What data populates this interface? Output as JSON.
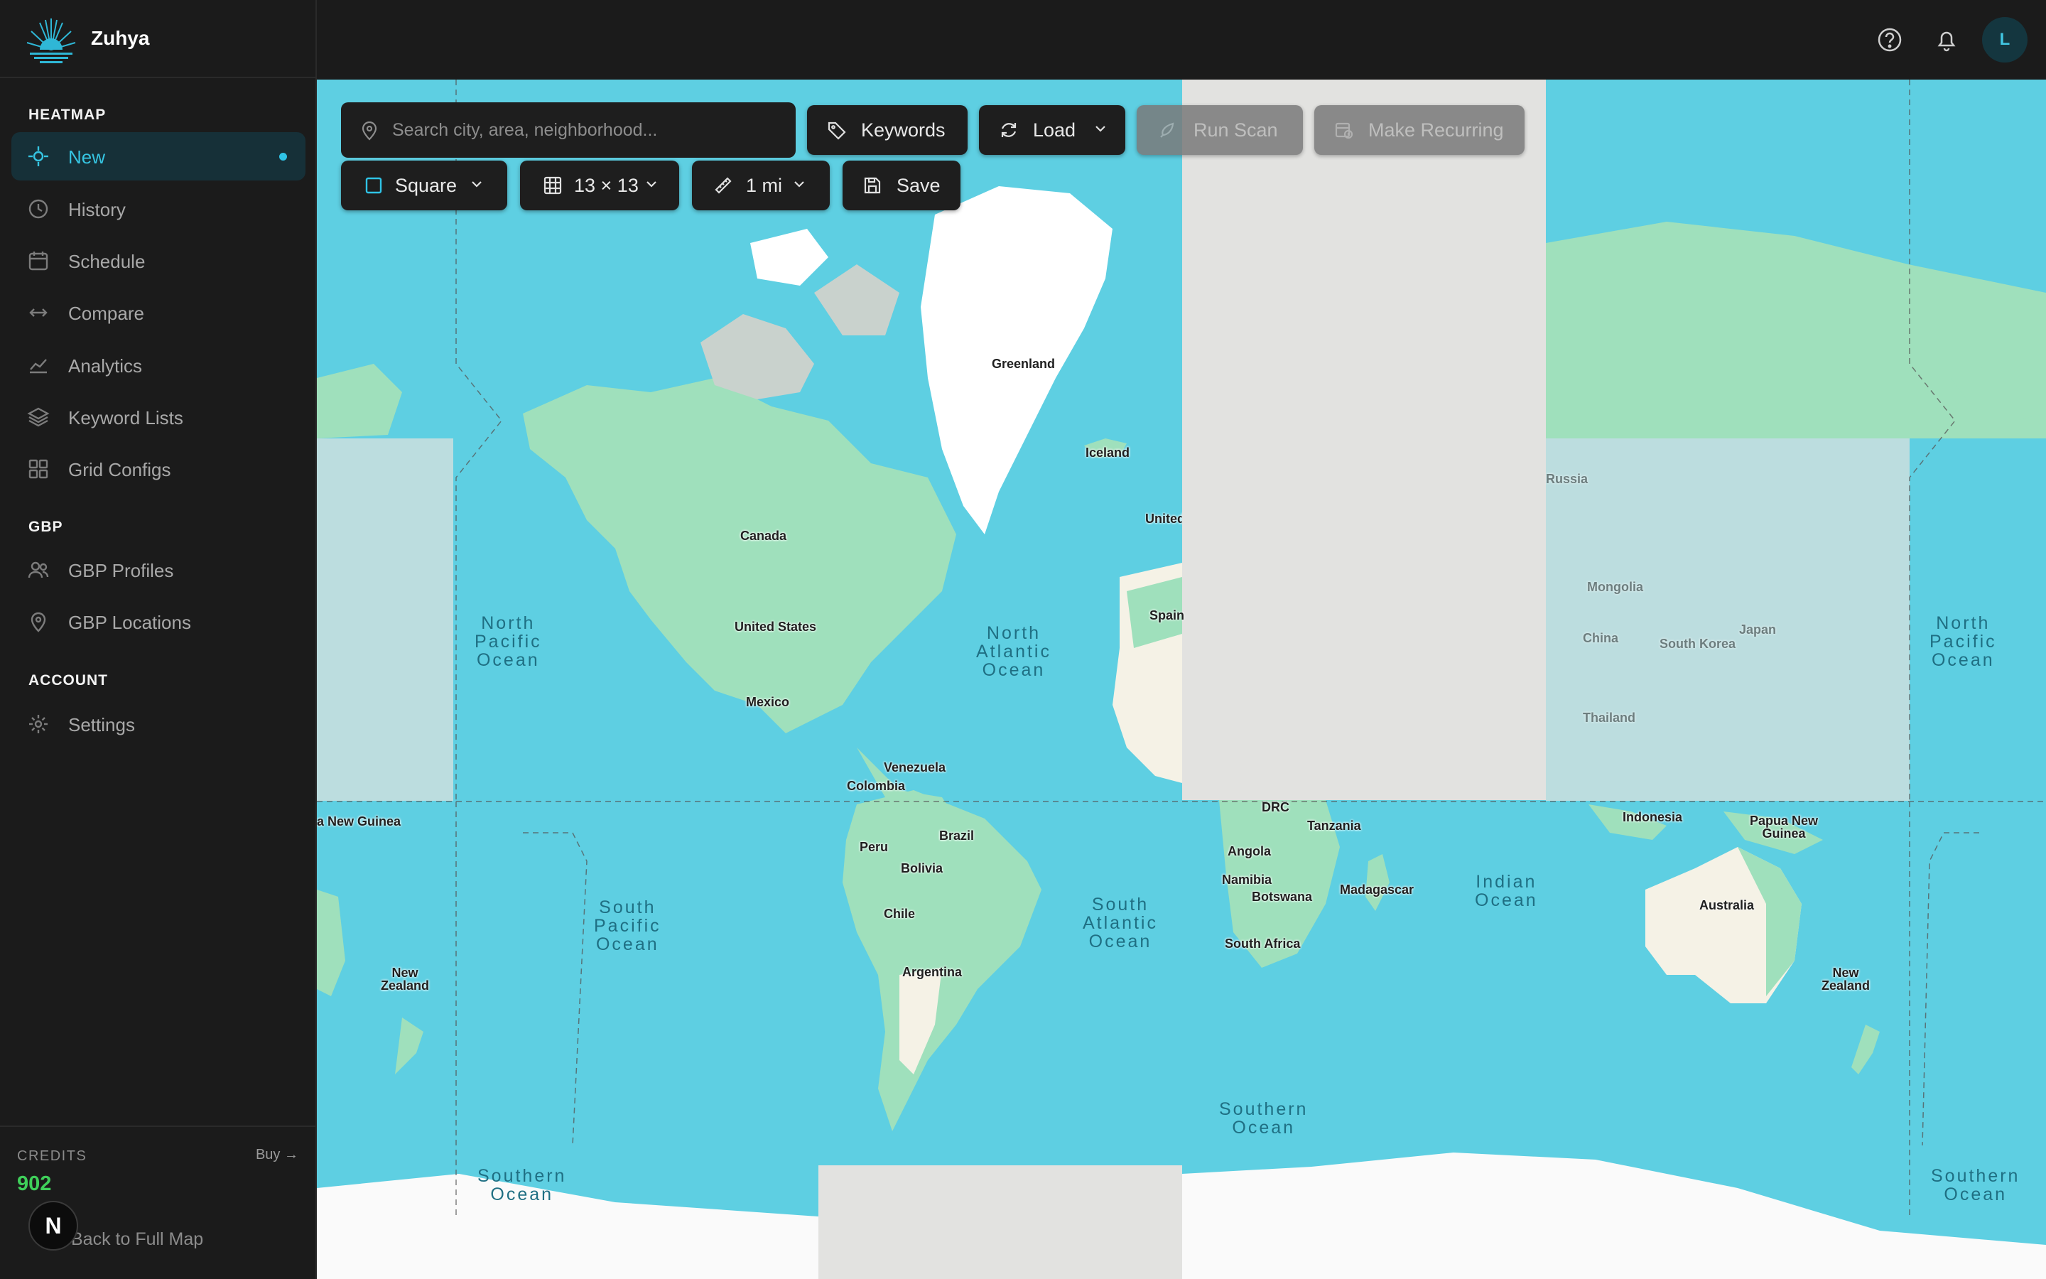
{
  "brand": {
    "name": "Zuhya"
  },
  "sidebar": {
    "sections": [
      {
        "label": "HEATMAP"
      },
      {
        "label": "GBP"
      },
      {
        "label": "ACCOUNT"
      }
    ],
    "items": [
      {
        "label": "New",
        "icon": "crosshair-icon",
        "active": true
      },
      {
        "label": "History",
        "icon": "clock-icon"
      },
      {
        "label": "Schedule",
        "icon": "calendar-icon"
      },
      {
        "label": "Compare",
        "icon": "arrows-left-right-icon"
      },
      {
        "label": "Analytics",
        "icon": "chart-line-icon"
      },
      {
        "label": "Keyword Lists",
        "icon": "layers-icon"
      },
      {
        "label": "Grid Configs",
        "icon": "grid-icon"
      },
      {
        "label": "GBP Profiles",
        "icon": "users-icon"
      },
      {
        "label": "GBP Locations",
        "icon": "map-pin-icon"
      },
      {
        "label": "Settings",
        "icon": "gear-icon"
      }
    ],
    "credits": {
      "label": "CREDITS",
      "buy": "Buy →",
      "value": "902"
    },
    "back_link": "Back to Full Map",
    "n_badge": "N"
  },
  "topbar": {
    "avatar": "L",
    "icons": [
      "help-icon",
      "bell-icon"
    ]
  },
  "toolbar": {
    "search_placeholder": "Search city, area, neighborhood...",
    "keywords": "Keywords",
    "load": "Load",
    "run_scan": "Run Scan",
    "make_recurring": "Make Recurring",
    "shape": "Square",
    "grid": "13 × 13",
    "distance": "1 mi",
    "save": "Save"
  },
  "map": {
    "labels": {
      "greenland": "Greenland",
      "iceland": "Iceland",
      "canada": "Canada",
      "usa": "United States",
      "mexico": "Mexico",
      "venezuela": "Venezuela",
      "colombia": "Colombia",
      "brazil": "Brazil",
      "peru": "Peru",
      "bolivia": "Bolivia",
      "chile": "Chile",
      "argentina": "Argentina",
      "uk": "United Kingdom",
      "spain": "Spain",
      "drc": "DRC",
      "tanzania": "Tanzania",
      "angola": "Angola",
      "namibia": "Namibia",
      "botswana": "Botswana",
      "south_africa": "South Africa",
      "madagascar": "Madagascar",
      "indonesia": "Indonesia",
      "png": "Papua New Guinea",
      "australia": "Australia",
      "nz": "New Zealand",
      "nz_left": "New Zealand",
      "russia": "Russia",
      "mongolia": "Mongolia",
      "china": "China",
      "south_korea": "South Korea",
      "japan": "Japan",
      "thailand": "Thailand",
      "png_left": "a New Guinea"
    },
    "oceans": {
      "north_pacific": "North\nPacific\nOcean",
      "north_atlantic": "North\nAtlantic\nOcean",
      "south_pacific": "South\nPacific\nOcean",
      "south_atlantic": "South\nAtlantic\nOcean",
      "indian": "Indian\nOcean",
      "southern": "Southern\nOcean",
      "southern_left": "Southern\nOcean",
      "southern_right": "Southern\nOcean",
      "north_pacific_right": "North\nPacific\nOcean"
    }
  }
}
